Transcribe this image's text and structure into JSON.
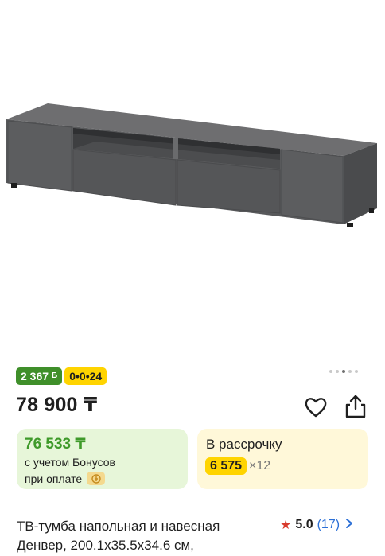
{
  "product": {
    "image_alt": "TV cabinet",
    "gallery_dots": 5,
    "gallery_active_index": 2,
    "badges": {
      "bonus_amount": "2 367",
      "bonus_currency": "Б",
      "installment_label": "0•0•24"
    },
    "price": "78 900 ₸",
    "bonus_card": {
      "price": "76 533 ₸",
      "line1": "с учетом Бонусов",
      "line2": "при оплате"
    },
    "installment_card": {
      "title": "В рассрочку",
      "amount": "6 575",
      "multiplier": "×12"
    },
    "title": "ТВ-тумба напольная и навесная Денвер, 200.1х35.5х34.6 см,",
    "rating": {
      "value": "5.0",
      "count": "(17)"
    }
  },
  "icons": {
    "favorite": "heart-icon",
    "share": "share-icon",
    "rating": "star-icon",
    "more": "chevron-right-icon",
    "payment": "kaspi-coin-icon"
  },
  "colors": {
    "bonus_green": "#3f8f2a",
    "install_yellow": "#ffd400",
    "rating_star": "#d83a2c",
    "link_blue": "#2b6fd6"
  }
}
